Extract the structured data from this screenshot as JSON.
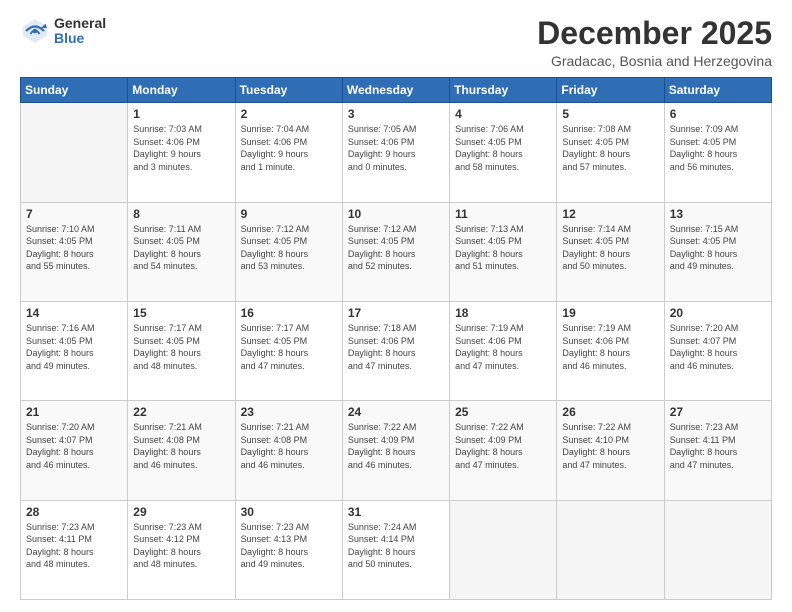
{
  "logo": {
    "general": "General",
    "blue": "Blue"
  },
  "header": {
    "title": "December 2025",
    "subtitle": "Gradacac, Bosnia and Herzegovina"
  },
  "days_of_week": [
    "Sunday",
    "Monday",
    "Tuesday",
    "Wednesday",
    "Thursday",
    "Friday",
    "Saturday"
  ],
  "weeks": [
    [
      {
        "day": "",
        "info": ""
      },
      {
        "day": "1",
        "info": "Sunrise: 7:03 AM\nSunset: 4:06 PM\nDaylight: 9 hours\nand 3 minutes."
      },
      {
        "day": "2",
        "info": "Sunrise: 7:04 AM\nSunset: 4:06 PM\nDaylight: 9 hours\nand 1 minute."
      },
      {
        "day": "3",
        "info": "Sunrise: 7:05 AM\nSunset: 4:06 PM\nDaylight: 9 hours\nand 0 minutes."
      },
      {
        "day": "4",
        "info": "Sunrise: 7:06 AM\nSunset: 4:05 PM\nDaylight: 8 hours\nand 58 minutes."
      },
      {
        "day": "5",
        "info": "Sunrise: 7:08 AM\nSunset: 4:05 PM\nDaylight: 8 hours\nand 57 minutes."
      },
      {
        "day": "6",
        "info": "Sunrise: 7:09 AM\nSunset: 4:05 PM\nDaylight: 8 hours\nand 56 minutes."
      }
    ],
    [
      {
        "day": "7",
        "info": "Sunrise: 7:10 AM\nSunset: 4:05 PM\nDaylight: 8 hours\nand 55 minutes."
      },
      {
        "day": "8",
        "info": "Sunrise: 7:11 AM\nSunset: 4:05 PM\nDaylight: 8 hours\nand 54 minutes."
      },
      {
        "day": "9",
        "info": "Sunrise: 7:12 AM\nSunset: 4:05 PM\nDaylight: 8 hours\nand 53 minutes."
      },
      {
        "day": "10",
        "info": "Sunrise: 7:12 AM\nSunset: 4:05 PM\nDaylight: 8 hours\nand 52 minutes."
      },
      {
        "day": "11",
        "info": "Sunrise: 7:13 AM\nSunset: 4:05 PM\nDaylight: 8 hours\nand 51 minutes."
      },
      {
        "day": "12",
        "info": "Sunrise: 7:14 AM\nSunset: 4:05 PM\nDaylight: 8 hours\nand 50 minutes."
      },
      {
        "day": "13",
        "info": "Sunrise: 7:15 AM\nSunset: 4:05 PM\nDaylight: 8 hours\nand 49 minutes."
      }
    ],
    [
      {
        "day": "14",
        "info": "Sunrise: 7:16 AM\nSunset: 4:05 PM\nDaylight: 8 hours\nand 49 minutes."
      },
      {
        "day": "15",
        "info": "Sunrise: 7:17 AM\nSunset: 4:05 PM\nDaylight: 8 hours\nand 48 minutes."
      },
      {
        "day": "16",
        "info": "Sunrise: 7:17 AM\nSunset: 4:05 PM\nDaylight: 8 hours\nand 47 minutes."
      },
      {
        "day": "17",
        "info": "Sunrise: 7:18 AM\nSunset: 4:06 PM\nDaylight: 8 hours\nand 47 minutes."
      },
      {
        "day": "18",
        "info": "Sunrise: 7:19 AM\nSunset: 4:06 PM\nDaylight: 8 hours\nand 47 minutes."
      },
      {
        "day": "19",
        "info": "Sunrise: 7:19 AM\nSunset: 4:06 PM\nDaylight: 8 hours\nand 46 minutes."
      },
      {
        "day": "20",
        "info": "Sunrise: 7:20 AM\nSunset: 4:07 PM\nDaylight: 8 hours\nand 46 minutes."
      }
    ],
    [
      {
        "day": "21",
        "info": "Sunrise: 7:20 AM\nSunset: 4:07 PM\nDaylight: 8 hours\nand 46 minutes."
      },
      {
        "day": "22",
        "info": "Sunrise: 7:21 AM\nSunset: 4:08 PM\nDaylight: 8 hours\nand 46 minutes."
      },
      {
        "day": "23",
        "info": "Sunrise: 7:21 AM\nSunset: 4:08 PM\nDaylight: 8 hours\nand 46 minutes."
      },
      {
        "day": "24",
        "info": "Sunrise: 7:22 AM\nSunset: 4:09 PM\nDaylight: 8 hours\nand 46 minutes."
      },
      {
        "day": "25",
        "info": "Sunrise: 7:22 AM\nSunset: 4:09 PM\nDaylight: 8 hours\nand 47 minutes."
      },
      {
        "day": "26",
        "info": "Sunrise: 7:22 AM\nSunset: 4:10 PM\nDaylight: 8 hours\nand 47 minutes."
      },
      {
        "day": "27",
        "info": "Sunrise: 7:23 AM\nSunset: 4:11 PM\nDaylight: 8 hours\nand 47 minutes."
      }
    ],
    [
      {
        "day": "28",
        "info": "Sunrise: 7:23 AM\nSunset: 4:11 PM\nDaylight: 8 hours\nand 48 minutes."
      },
      {
        "day": "29",
        "info": "Sunrise: 7:23 AM\nSunset: 4:12 PM\nDaylight: 8 hours\nand 48 minutes."
      },
      {
        "day": "30",
        "info": "Sunrise: 7:23 AM\nSunset: 4:13 PM\nDaylight: 8 hours\nand 49 minutes."
      },
      {
        "day": "31",
        "info": "Sunrise: 7:24 AM\nSunset: 4:14 PM\nDaylight: 8 hours\nand 50 minutes."
      },
      {
        "day": "",
        "info": ""
      },
      {
        "day": "",
        "info": ""
      },
      {
        "day": "",
        "info": ""
      }
    ]
  ]
}
